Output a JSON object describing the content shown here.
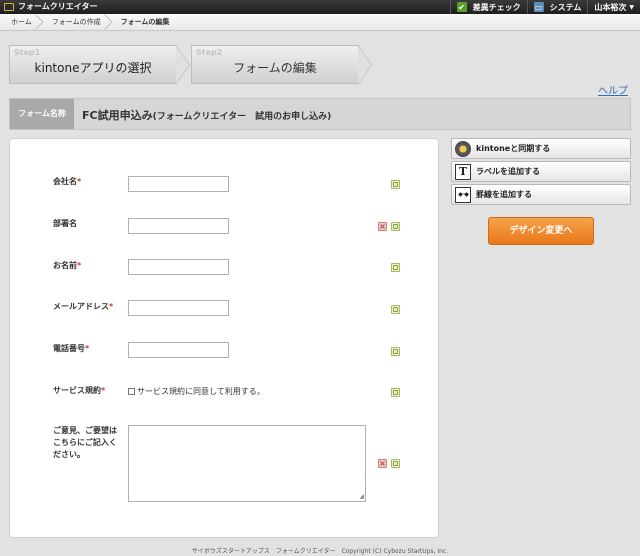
{
  "app": {
    "title": "フォームクリエイター"
  },
  "top_menu": {
    "diff_check": "差異チェック",
    "system": "システム",
    "user": "山本裕次"
  },
  "breadcrumb": [
    "ホーム",
    "フォームの作成",
    "フォームの編集"
  ],
  "steps": [
    {
      "num": "Step1",
      "label": "kintoneアプリの選択"
    },
    {
      "num": "Step2",
      "label": "フォームの編集"
    }
  ],
  "help": "ヘルプ",
  "form_name": {
    "label": "フォーム名称",
    "value": "FC試用申込み",
    "sub": "(フォームクリエイター　試用のお申し込み)"
  },
  "fields": [
    {
      "label": "会社名",
      "required": "*",
      "value": ""
    },
    {
      "label": "部署名",
      "required": "",
      "value": ""
    },
    {
      "label": "お名前",
      "required": "*",
      "value": ""
    },
    {
      "label": "メールアドレス",
      "required": "*",
      "value": ""
    },
    {
      "label": "電話番号",
      "required": "*",
      "value": ""
    },
    {
      "label": "サービス規約",
      "required": "*",
      "checkbox_text": "サービス規約に同意して利用する。",
      "checked": false
    },
    {
      "label": "ご意見、ご要望はこちらにご記入ください。",
      "required": "",
      "value": ""
    }
  ],
  "tools": {
    "sync": "kintoneと同期する",
    "add_label": "ラベルを追加する",
    "add_rule": "罫線を追加する",
    "design": "デザイン変更へ"
  },
  "footer": "サイボウズスタートアップス　フォームクリエイター　Copyright (C) Cybozu StartUps, Inc."
}
